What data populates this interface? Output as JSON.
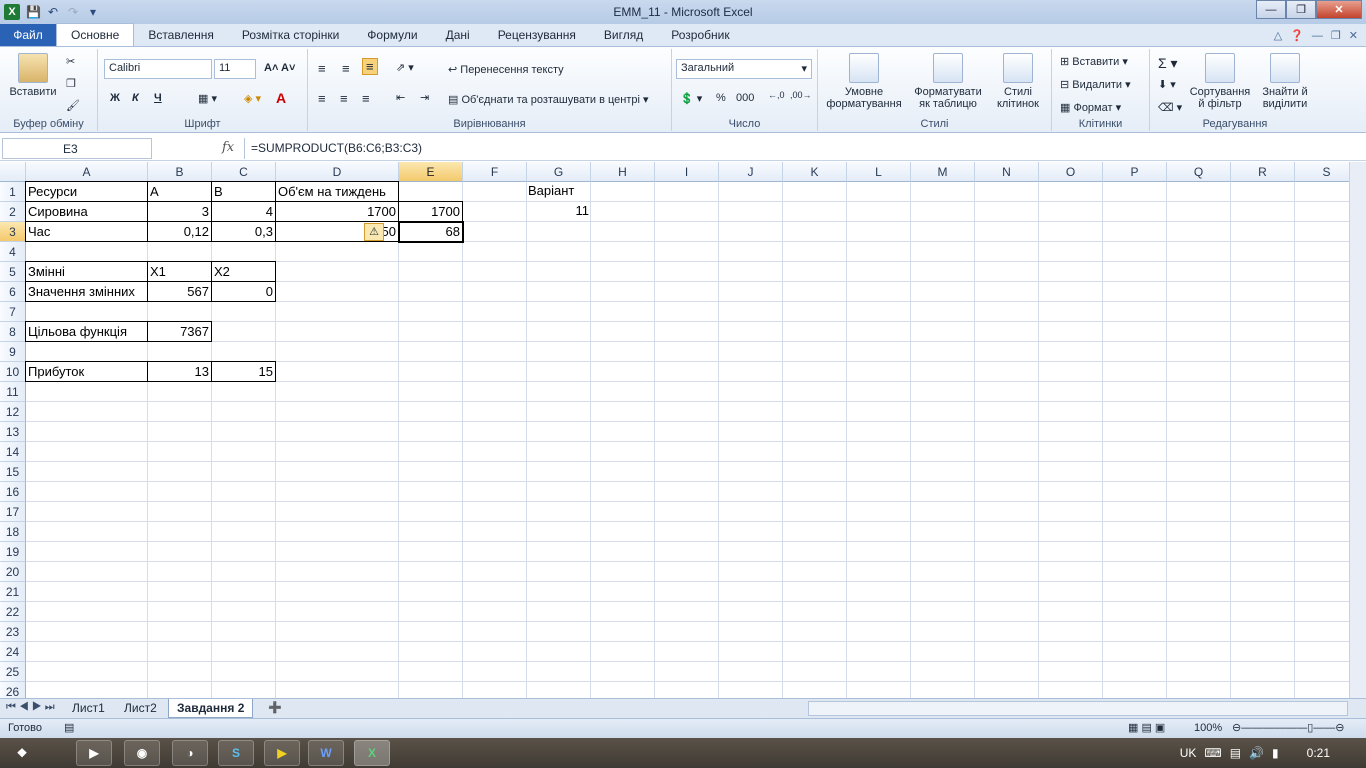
{
  "window": {
    "title": "EMM_11  -  Microsoft Excel"
  },
  "tabs": {
    "file": "Файл",
    "items": [
      "Основне",
      "Вставлення",
      "Розмітка сторінки",
      "Формули",
      "Дані",
      "Рецензування",
      "Вигляд",
      "Розробник"
    ]
  },
  "ribbon": {
    "clipboard": {
      "paste": "Вставити",
      "label": "Буфер обміну"
    },
    "font": {
      "name": "Calibri",
      "size": "11",
      "label": "Шрифт",
      "bold": "Ж",
      "italic": "К",
      "underline": "Ч"
    },
    "alignment": {
      "wrap": "Перенесення тексту",
      "merge": "Об'єднати та розташувати в центрі",
      "label": "Вирівнювання"
    },
    "number": {
      "format": "Загальний",
      "percent": "%",
      "thousands": "000",
      "label": "Число"
    },
    "styles": {
      "cond": "Умовне",
      "cond2": "форматування",
      "table": "Форматувати",
      "table2": "як таблицю",
      "cell": "Стилі",
      "cell2": "клітинок",
      "label": "Стилі"
    },
    "cells": {
      "insert": "Вставити",
      "delete": "Видалити",
      "format": "Формат",
      "label": "Клітинки"
    },
    "editing": {
      "sort": "Сортування",
      "sort2": "й фільтр",
      "find": "Знайти й",
      "find2": "виділити",
      "label": "Редагування"
    }
  },
  "formula_bar": {
    "name_box": "E3",
    "fx": "fx",
    "formula": "=SUMPRODUCT(B6:C6;B3:C3)"
  },
  "columns": [
    "A",
    "B",
    "C",
    "D",
    "E",
    "F",
    "G",
    "H",
    "I",
    "J",
    "K",
    "L",
    "M",
    "N",
    "O",
    "P",
    "Q",
    "R",
    "S"
  ],
  "rows": [
    "1",
    "2",
    "3",
    "4",
    "5",
    "6",
    "7",
    "8",
    "9",
    "10",
    "11",
    "12",
    "13",
    "14",
    "15",
    "16",
    "17",
    "18",
    "19",
    "20",
    "21",
    "22",
    "23",
    "24",
    "25",
    "26"
  ],
  "cells": {
    "A1": "Ресурси",
    "B1": "A",
    "C1": "B",
    "D1": "Об'єм на тиждень",
    "G1": "Варіант",
    "A2": "Сировина",
    "B2": "3",
    "C2": "4",
    "D2": "1700",
    "E2": "1700",
    "G2": "11",
    "A3": "Час",
    "B3": "0,12",
    "C3": "0,3",
    "D3": "50",
    "E3": "68",
    "A5": "Змінні",
    "B5": "X1",
    "C5": "X2",
    "A6": "Значення змінних",
    "B6": "567",
    "C6": "0",
    "A8": "Цільова функція",
    "B8": "7367",
    "A10": "Прибуток",
    "B10": "13",
    "C10": "15"
  },
  "sheets": [
    "Лист1",
    "Лист2",
    "Завдання 2"
  ],
  "active_sheet": "Завдання 2",
  "status": {
    "ready": "Готово",
    "zoom": "100%"
  },
  "taskbar": {
    "lang": "UK",
    "time": "0:21"
  }
}
